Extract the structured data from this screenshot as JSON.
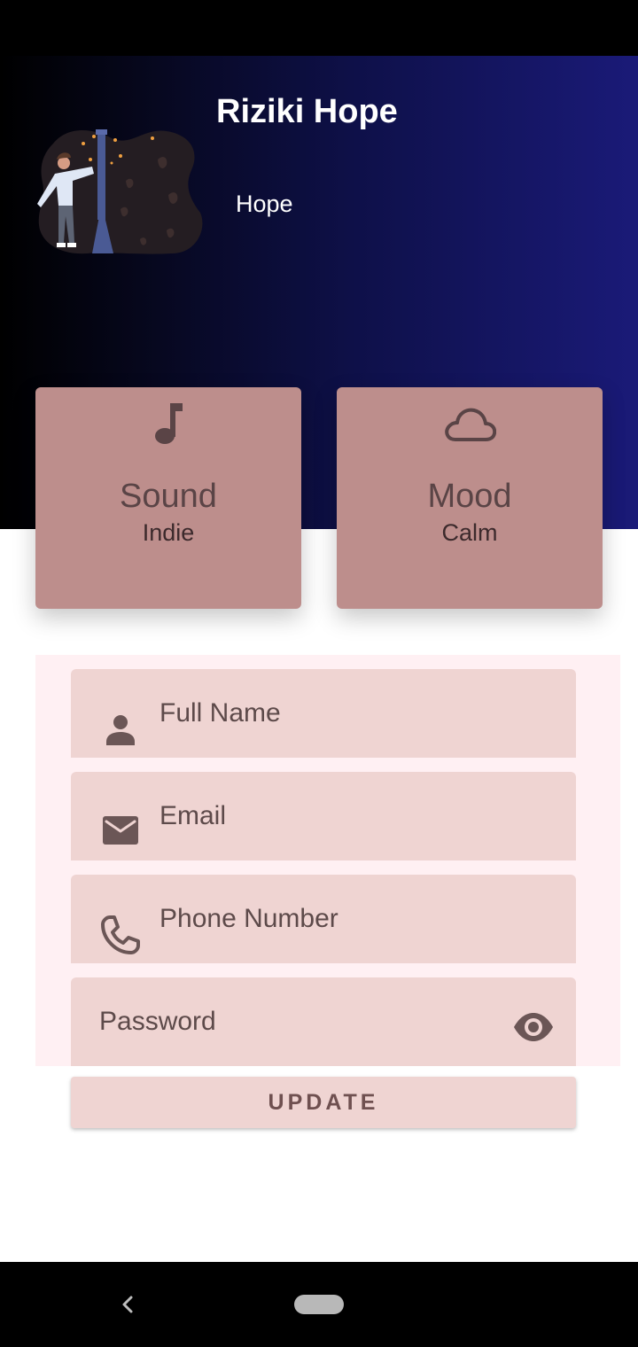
{
  "profile": {
    "name": "Riziki Hope",
    "username": "Hope"
  },
  "cards": {
    "sound": {
      "title": "Sound",
      "value": "Indie",
      "icon": "music-note-icon"
    },
    "mood": {
      "title": "Mood",
      "value": "Calm",
      "icon": "cloud-icon"
    }
  },
  "form": {
    "full_name": {
      "label": "Full Name",
      "icon": "person-icon"
    },
    "email": {
      "label": "Email",
      "icon": "mail-icon"
    },
    "phone": {
      "label": "Phone Number",
      "icon": "phone-icon"
    },
    "password": {
      "label": "Password",
      "icon": "eye-icon"
    },
    "update_label": "UPDATE"
  },
  "navigation": {
    "back_icon": "back-chevron-icon",
    "home_icon": "home-pill-icon"
  },
  "colors": {
    "header_gradient_start": "#000000",
    "header_gradient_end": "#1a1a78",
    "card": "#bd8e8c",
    "field": "#efd4d2",
    "form_background": "#fff0f3",
    "icon": "#6b5656"
  }
}
